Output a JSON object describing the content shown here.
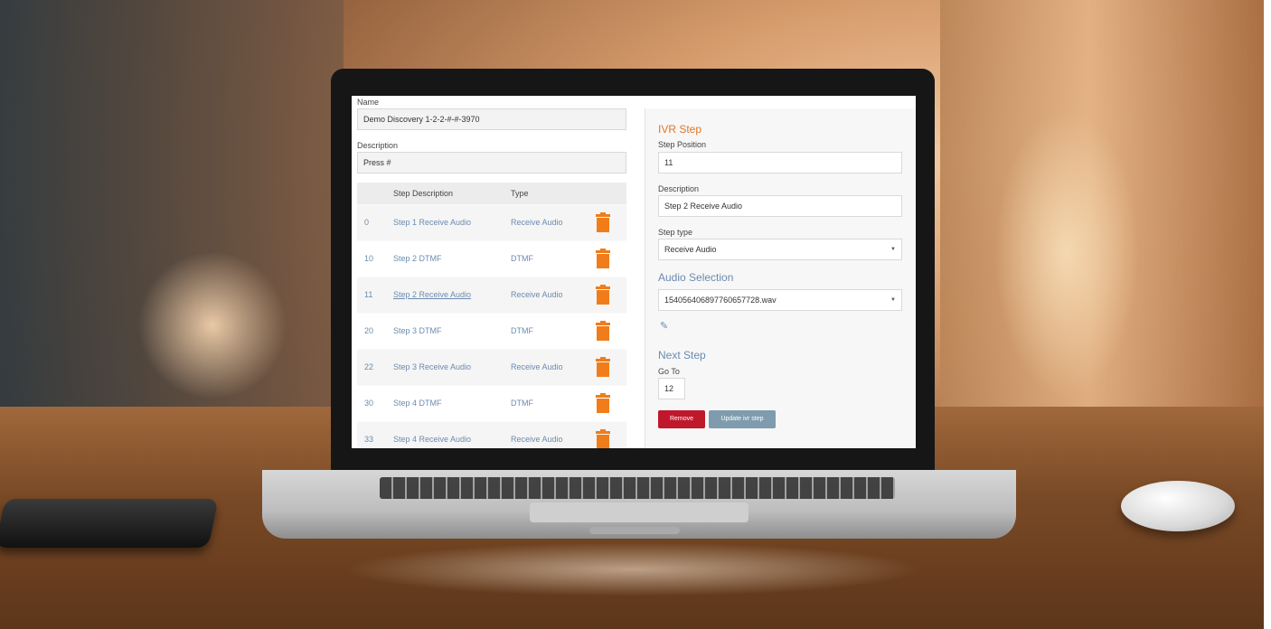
{
  "form": {
    "name_label": "Name",
    "name_value": "Demo Discovery 1-2-2-#-#-3970",
    "description_label": "Description",
    "description_value": "Press #"
  },
  "steps_table": {
    "headers": [
      "",
      "Step Description",
      "Type"
    ],
    "rows": [
      {
        "position": "0",
        "description": "Step 1 Receive Audio",
        "type": "Receive Audio"
      },
      {
        "position": "10",
        "description": "Step 2 DTMF",
        "type": "DTMF"
      },
      {
        "position": "11",
        "description": "Step 2 Receive Audio",
        "type": "Receive Audio",
        "selected": true
      },
      {
        "position": "20",
        "description": "Step 3 DTMF",
        "type": "DTMF"
      },
      {
        "position": "22",
        "description": "Step 3 Receive Audio",
        "type": "Receive Audio"
      },
      {
        "position": "30",
        "description": "Step 4 DTMF",
        "type": "DTMF"
      },
      {
        "position": "33",
        "description": "Step 4 Receive Audio",
        "type": "Receive Audio"
      }
    ]
  },
  "ivr_step": {
    "title": "IVR Step",
    "step_position_label": "Step Position",
    "step_position_value": "11",
    "description_label": "Description",
    "description_value": "Step 2 Receive Audio",
    "step_type_label": "Step type",
    "step_type_value": "Receive Audio",
    "audio_selection_title": "Audio Selection",
    "audio_selection_value": "15405640689776065772​8.wav",
    "next_step_title": "Next Step",
    "go_to_label": "Go To",
    "go_to_value": "12",
    "remove_label": "Remove",
    "update_label": "Update ivr step"
  },
  "colors": {
    "accent": "#e0762a",
    "link": "#6b8bb0",
    "trash": "#f07d1a",
    "remove_button": "#c0182b",
    "update_button": "#7f9cae"
  },
  "icons": {
    "delete": "trash-icon",
    "edit": "edit-icon"
  }
}
